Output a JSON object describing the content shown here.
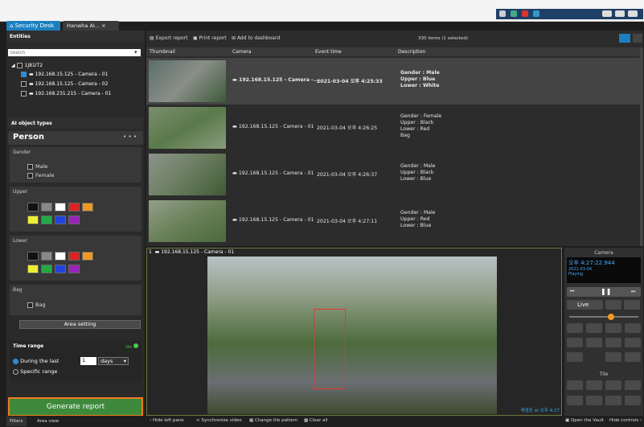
{
  "tabs": [
    {
      "label": "Security Desk"
    },
    {
      "label": "Hanwha AI..."
    }
  ],
  "entities": {
    "title": "Entities",
    "search_placeholder": "Search",
    "root": "1J81IT2",
    "items": [
      "192.168.15.125 - Camera - 01",
      "192.168.15.125 - Camera - 02",
      "192.168.231.215 - Camera - 01"
    ]
  },
  "ai": {
    "title": "AI object types",
    "object": "Person",
    "gender_title": "Gender",
    "male": "Male",
    "female": "Female",
    "upper_title": "Upper",
    "lower_title": "Lower",
    "bag_title": "Bag",
    "bag": "Bag",
    "area_setting": "Area setting",
    "colors": [
      "#111111",
      "#888888",
      "#ffffff",
      "#dd2222",
      "#ee9922",
      "#eeee33",
      "#22aa44",
      "#2244dd",
      "#9922bb"
    ]
  },
  "time": {
    "title": "Time range",
    "on": "On",
    "during": "During the last",
    "value": "1",
    "unit": "days",
    "specific": "Specific range"
  },
  "generate": "Generate report",
  "bottom_tabs": [
    "Filters",
    "Area view"
  ],
  "toolbar": {
    "export": "Export report",
    "print": "Print report",
    "add": "Add to dashboard",
    "count": "330 items (1 selected)"
  },
  "table": {
    "headers": [
      "Thumbnail",
      "Camera",
      "Event time",
      "Description"
    ],
    "rows": [
      {
        "camera": "192.168.15.125 - Camera -...",
        "time": "2021-03-04 오후 4:25:33",
        "desc": [
          "Gender : Male",
          "Upper : Blue",
          "Lower : White"
        ]
      },
      {
        "camera": "192.168.15.125 - Camera - 01",
        "time": "2021-03-04 오후 4:26:25",
        "desc": [
          "Gender : Female",
          "Upper : Black",
          "Lower : Red",
          "Bag"
        ]
      },
      {
        "camera": "192.168.15.125 - Camera - 01",
        "time": "2021-03-04 오후 4:26:37",
        "desc": [
          "Gender : Male",
          "Upper : Black",
          "Lower : Blue"
        ]
      },
      {
        "camera": "192.168.15.125 - Camera - 01",
        "time": "2021-03-04 오후 4:27:11",
        "desc": [
          "Gender : Male",
          "Upper : Red",
          "Lower : Blue"
        ]
      }
    ]
  },
  "video": {
    "tile": "1",
    "camera": "192.168.15.125 - Camera - 01",
    "overlay": "재생중 at 오후 4:27"
  },
  "controls": {
    "title": "Camera",
    "time": "오후 4:27:22.944",
    "date": "2021-03-04",
    "state": "Playing",
    "live": "Live",
    "tile": "Tile"
  },
  "bottombar": {
    "hide_left": "Hide left pane",
    "sync": "Synchronize video",
    "pattern": "Change tile pattern",
    "clear": "Clear all",
    "vault": "Open the Vault",
    "hide_controls": "Hide controls"
  }
}
